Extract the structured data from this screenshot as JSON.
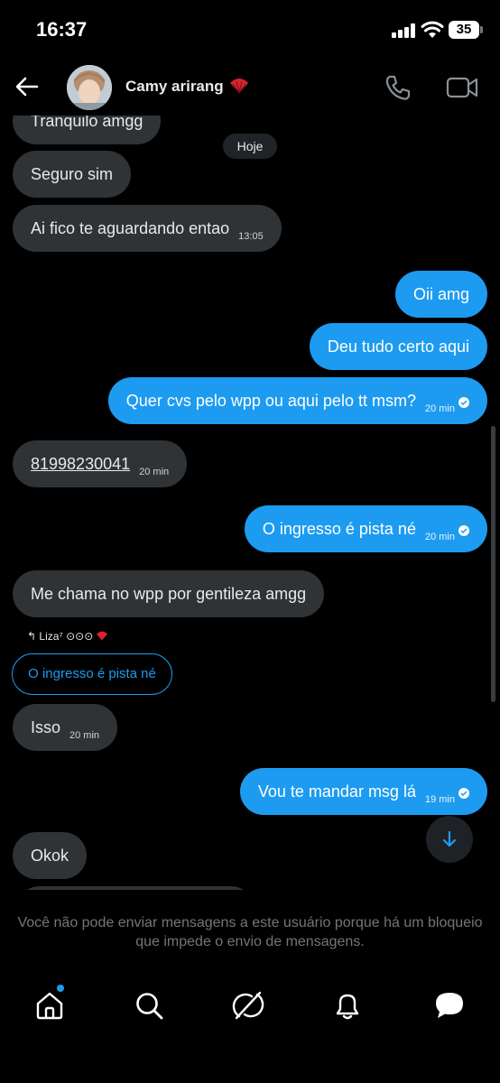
{
  "status_bar": {
    "time": "16:37",
    "battery": "35"
  },
  "header": {
    "contact_name": "Camy arirang"
  },
  "chat": {
    "day_separator": "Hoje",
    "messages": [
      {
        "dir": "in",
        "text": "Tranquilo amgg",
        "time": ""
      },
      {
        "dir": "in",
        "text": "Seguro sim",
        "time": ""
      },
      {
        "dir": "in",
        "text": "Ai fico te aguardando entao",
        "time": "13:05"
      },
      {
        "dir": "out",
        "text": "Oii amg",
        "time": ""
      },
      {
        "dir": "out",
        "text": "Deu tudo certo aqui",
        "time": ""
      },
      {
        "dir": "out",
        "text": "Quer cvs pelo wpp ou aqui pelo tt msm?",
        "time": "20 min"
      },
      {
        "dir": "in",
        "text": "81998230041",
        "time": "20 min"
      },
      {
        "dir": "out",
        "text": "O ingresso é pista né",
        "time": "20 min"
      },
      {
        "dir": "in",
        "text": "Me chama no wpp por gentileza amgg",
        "time": ""
      },
      {
        "dir": "in",
        "text": "Isso",
        "time": "20 min"
      },
      {
        "dir": "out",
        "text": "Vou te mandar msg lá",
        "time": "19 min"
      },
      {
        "dir": "in",
        "text": "Okok",
        "time": ""
      }
    ],
    "reply_reference": {
      "label": "↰ Liza⁷ ⊙⊙⊙",
      "quoted_text": "O ingresso é pista né"
    }
  },
  "notice": "Você não pode enviar mensagens a este usuário porque há um bloqueio que impede o envio de mensagens.",
  "nav": {
    "items": [
      "home",
      "search",
      "grok",
      "notifications",
      "messages"
    ]
  },
  "colors": {
    "accent": "#1d9bf0",
    "incoming_bubble": "#2f3336",
    "background": "#000000",
    "muted_text": "#71767b"
  }
}
